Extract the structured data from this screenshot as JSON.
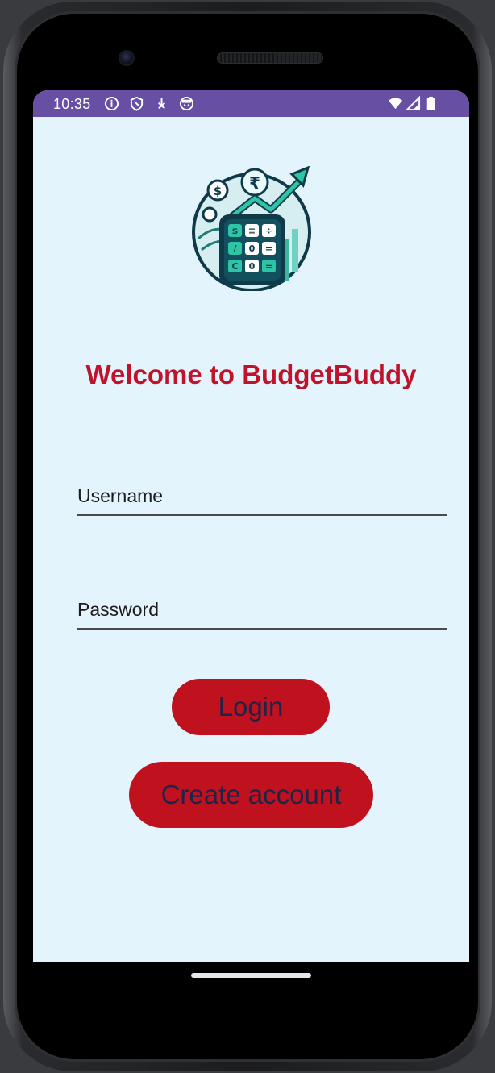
{
  "status_bar": {
    "time": "10:35",
    "color": "#6750a4",
    "left_icons": [
      "info-icon",
      "shield-icon",
      "download-icon",
      "face-icon"
    ],
    "right_icons": [
      "wifi-icon",
      "signal-icon",
      "battery-icon"
    ]
  },
  "app": {
    "logo": "budgetbuddy-logo",
    "welcome_text": "Welcome to BudgetBuddy",
    "welcome_color": "#c0122a",
    "background": "#e4f4fc"
  },
  "form": {
    "username_placeholder": "Username",
    "password_placeholder": "Password"
  },
  "buttons": {
    "login_label": "Login",
    "create_account_label": "Create account",
    "color": "#c0111f",
    "text_color": "#1f2347"
  }
}
